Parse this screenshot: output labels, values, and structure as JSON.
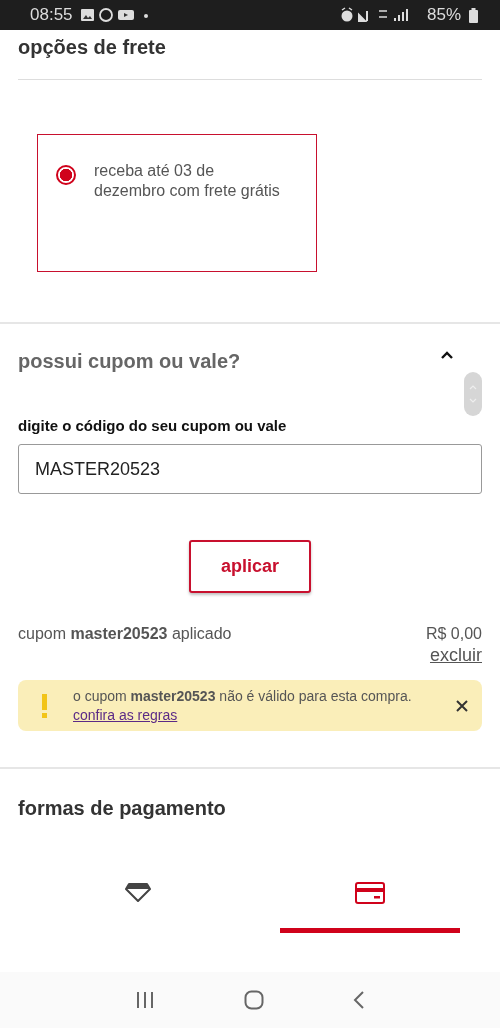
{
  "status_bar": {
    "time": "08:55",
    "battery": "85%"
  },
  "shipping": {
    "title": "opções de frete",
    "options": [
      {
        "label": "receba até 03 de dezembro com frete grátis",
        "selected": true
      }
    ]
  },
  "coupon": {
    "title": "possui cupom ou vale?",
    "expanded": true,
    "field_label": "digite o código do seu cupom ou vale",
    "value": "MASTER20523",
    "apply_button": "aplicar",
    "applied_text": "cupom **master20523** aplicado",
    "discount": "R$ 0,00",
    "remove_link": "excluir",
    "alert": {
      "message": "o cupom **master20523** não é válido para esta compra.",
      "link": "confira as regras"
    }
  },
  "payment": {
    "title": "formas de pagamento",
    "tabs": [
      {
        "kind": "diamond",
        "selected": false
      },
      {
        "kind": "card",
        "selected": true
      }
    ]
  }
}
